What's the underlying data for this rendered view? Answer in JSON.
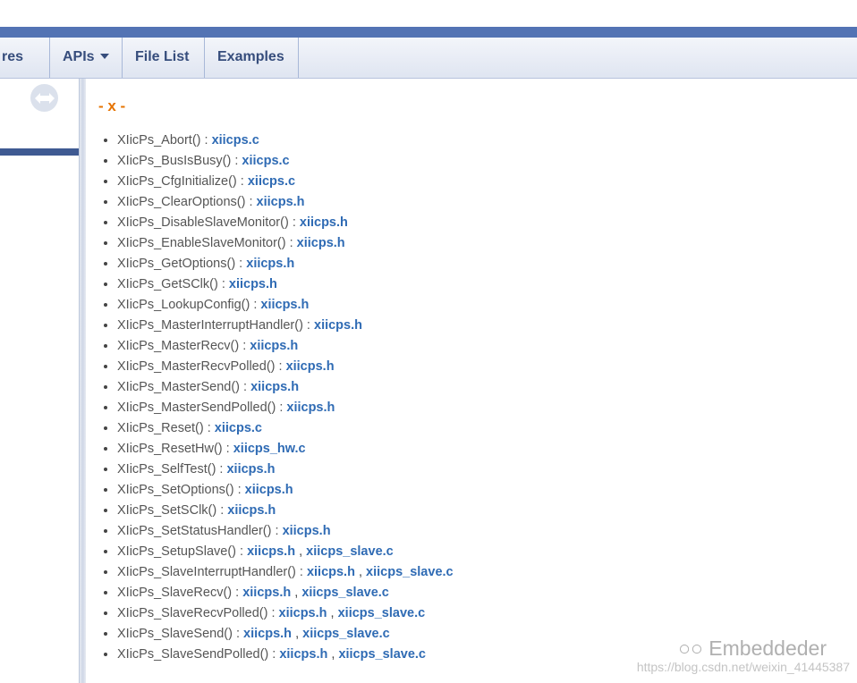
{
  "nav": {
    "items": [
      {
        "label": "res",
        "caret": true
      },
      {
        "label": "APIs",
        "caret": true
      },
      {
        "label": "File List",
        "caret": false
      },
      {
        "label": "Examples",
        "caret": false
      }
    ]
  },
  "sidebar": {
    "sync_icon": "sync-arrows-icon"
  },
  "content": {
    "heading": "- x -",
    "entries": [
      {
        "fn": "XIicPs_Abort() : ",
        "links": [
          "xiicps.c"
        ]
      },
      {
        "fn": "XIicPs_BusIsBusy() : ",
        "links": [
          "xiicps.c"
        ]
      },
      {
        "fn": "XIicPs_CfgInitialize() : ",
        "links": [
          "xiicps.c"
        ]
      },
      {
        "fn": "XIicPs_ClearOptions() : ",
        "links": [
          "xiicps.h"
        ]
      },
      {
        "fn": "XIicPs_DisableSlaveMonitor() : ",
        "links": [
          "xiicps.h"
        ]
      },
      {
        "fn": "XIicPs_EnableSlaveMonitor() : ",
        "links": [
          "xiicps.h"
        ]
      },
      {
        "fn": "XIicPs_GetOptions() : ",
        "links": [
          "xiicps.h"
        ]
      },
      {
        "fn": "XIicPs_GetSClk() : ",
        "links": [
          "xiicps.h"
        ]
      },
      {
        "fn": "XIicPs_LookupConfig() : ",
        "links": [
          "xiicps.h"
        ]
      },
      {
        "fn": "XIicPs_MasterInterruptHandler() : ",
        "links": [
          "xiicps.h"
        ]
      },
      {
        "fn": "XIicPs_MasterRecv() : ",
        "links": [
          "xiicps.h"
        ]
      },
      {
        "fn": "XIicPs_MasterRecvPolled() : ",
        "links": [
          "xiicps.h"
        ]
      },
      {
        "fn": "XIicPs_MasterSend() : ",
        "links": [
          "xiicps.h"
        ]
      },
      {
        "fn": "XIicPs_MasterSendPolled() : ",
        "links": [
          "xiicps.h"
        ]
      },
      {
        "fn": "XIicPs_Reset() : ",
        "links": [
          "xiicps.c"
        ]
      },
      {
        "fn": "XIicPs_ResetHw() : ",
        "links": [
          "xiicps_hw.c"
        ]
      },
      {
        "fn": "XIicPs_SelfTest() : ",
        "links": [
          "xiicps.h"
        ]
      },
      {
        "fn": "XIicPs_SetOptions() : ",
        "links": [
          "xiicps.h"
        ]
      },
      {
        "fn": "XIicPs_SetSClk() : ",
        "links": [
          "xiicps.h"
        ]
      },
      {
        "fn": "XIicPs_SetStatusHandler() : ",
        "links": [
          "xiicps.h"
        ]
      },
      {
        "fn": "XIicPs_SetupSlave() : ",
        "links": [
          "xiicps.h",
          "xiicps_slave.c"
        ]
      },
      {
        "fn": "XIicPs_SlaveInterruptHandler() : ",
        "links": [
          "xiicps.h",
          "xiicps_slave.c"
        ]
      },
      {
        "fn": "XIicPs_SlaveRecv() : ",
        "links": [
          "xiicps.h",
          "xiicps_slave.c"
        ]
      },
      {
        "fn": "XIicPs_SlaveRecvPolled() : ",
        "links": [
          "xiicps.h",
          "xiicps_slave.c"
        ]
      },
      {
        "fn": "XIicPs_SlaveSend() : ",
        "links": [
          "xiicps.h",
          "xiicps_slave.c"
        ]
      },
      {
        "fn": "XIicPs_SlaveSendPolled() : ",
        "links": [
          "xiicps.h",
          "xiicps_slave.c"
        ]
      }
    ]
  },
  "watermark": {
    "brand": "Embeddeder",
    "url": "https://blog.csdn.net/weixin_41445387"
  }
}
